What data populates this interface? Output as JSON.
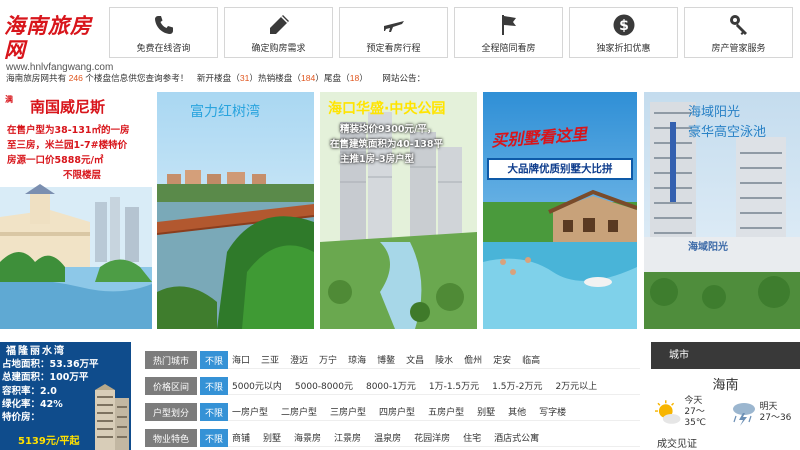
{
  "logo": {
    "title": "海南旅房网",
    "url_text": "www.hnlvfangwang.com"
  },
  "nav": [
    {
      "label": "免费在线咨询",
      "icon": "phone-icon"
    },
    {
      "label": "确定购房需求",
      "icon": "pencil-icon"
    },
    {
      "label": "预定看房行程",
      "icon": "airplane-icon"
    },
    {
      "label": "全程陪同看房",
      "icon": "flag-icon"
    },
    {
      "label": "独家折扣优惠",
      "icon": "dollar-icon"
    },
    {
      "label": "房产管家服务",
      "icon": "key-icon"
    }
  ],
  "info": {
    "prefix": "海南旅房网共有",
    "total": "246",
    "total_suffix": "个楼盘信息供您查询参考！",
    "new_label": "新开楼盘（",
    "new_count": "31",
    "hot_label": "）热销楼盘（",
    "hot_count": "184",
    "tail_label": "）尾盘（",
    "tail_count": "18",
    "close": "）",
    "notice": "网站公告："
  },
  "banners": {
    "b1": {
      "title": "南国威尼斯",
      "tag": "满",
      "lines": [
        "在售户型为38-131㎡的一房",
        "至三房，米兰园1-7#楼特价",
        "房源一口价5888元/㎡",
        "不限楼层"
      ]
    },
    "b2": {
      "title": "富力红树湾"
    },
    "b3": {
      "title": "海口华盛·中央公园",
      "lines": [
        "精装均价9300元/平，",
        "在售建筑面积为40-138平",
        "主推1房-3房户型"
      ]
    },
    "b4": {
      "title": "买别墅看这里",
      "sub": "大品牌优质别墅大比拼"
    },
    "b5": {
      "title1": "海域阳光",
      "title2": "豪华高空泳池",
      "sign": "海域阳光"
    }
  },
  "featured": {
    "name": "福隆丽水湾",
    "lines": [
      "占地面积：53.36万平",
      "总建面积：100万平",
      "容积率：2.0",
      "绿化率：42%",
      "特价房："
    ],
    "price": "5139元/平起"
  },
  "filters": [
    {
      "label": "热门城市",
      "all": "不限",
      "options": [
        "海口",
        "三亚",
        "澄迈",
        "万宁",
        "琼海",
        "博鳌",
        "文昌",
        "陵水",
        "儋州",
        "定安",
        "临高"
      ]
    },
    {
      "label": "价格区间",
      "all": "不限",
      "options": [
        "5000元以内",
        "5000-8000元",
        "8000-1万元",
        "1万-1.5万元",
        "1.5万-2万元",
        "2万元以上"
      ]
    },
    {
      "label": "户型划分",
      "all": "不限",
      "options": [
        "一房户型",
        "二房户型",
        "三房户型",
        "四房户型",
        "五房户型",
        "别墅",
        "其他",
        "写字楼"
      ]
    },
    {
      "label": "物业特色",
      "all": "不限",
      "options": [
        "商铺",
        "别墅",
        "海景房",
        "江景房",
        "温泉房",
        "花园洋房",
        "住宅",
        "酒店式公寓"
      ]
    }
  ],
  "weather": {
    "header": "城市",
    "city": "海南",
    "today_label": "今天",
    "today_temp": "27～35℃",
    "tomorrow_label": "明天",
    "tomorrow_temp": "27～36",
    "bottom_word": "成交见证"
  },
  "colors": {
    "logo_red": "#d8151b",
    "num_orange": "#e0561f",
    "filter_blue": "#3592d6",
    "filter_gray": "#7c7c7c",
    "featured_blue": "#0f4c8c",
    "weather_header": "#393939"
  }
}
